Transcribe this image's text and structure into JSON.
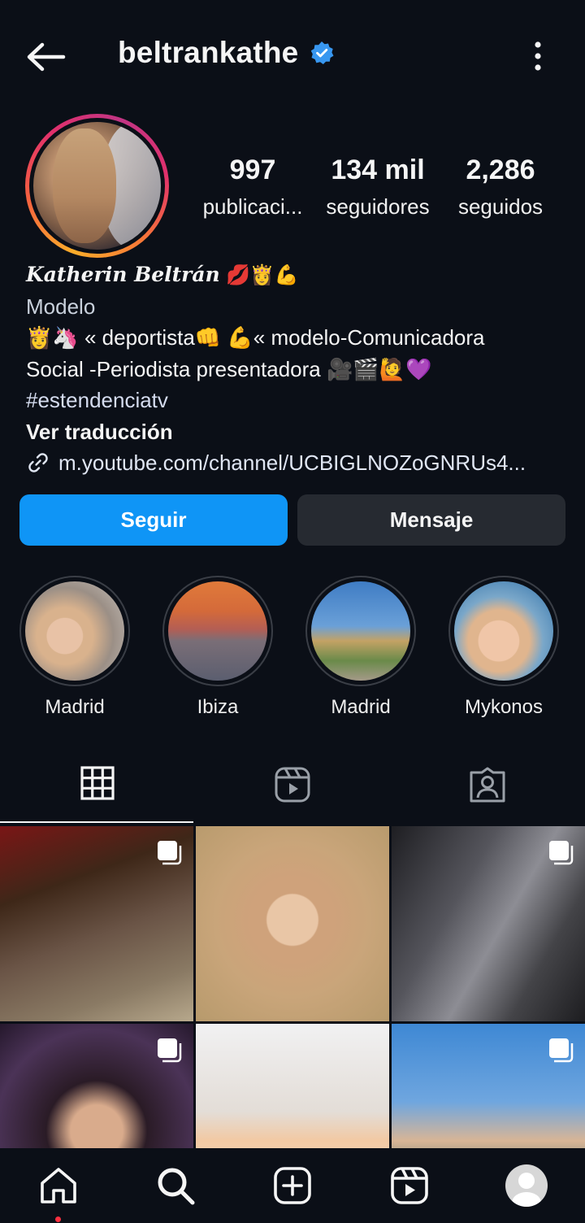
{
  "header": {
    "username": "beltrankathe",
    "back_icon": "back-arrow-icon",
    "verified_icon": "verified-badge-icon",
    "menu_icon": "more-vertical-icon",
    "verified_color": "#3897f0"
  },
  "stats": {
    "posts": {
      "value": "997",
      "label": "publicaci..."
    },
    "followers": {
      "value": "134 mil",
      "label": "seguidores"
    },
    "following": {
      "value": "2,286",
      "label": "seguidos"
    }
  },
  "bio": {
    "name": "Katherin Beltrán",
    "name_emojis": "💋👸💪",
    "category": "Modelo",
    "line1": "👸🦄 « deportista👊 💪« modelo-Comunicadora",
    "line2": "Social -Periodista presentadora 🎥🎬🙋💜",
    "hashtag": "#estendenciatv",
    "translate": "Ver traducción",
    "link": "m.youtube.com/channel/UCBIGLNOZoGNRUs4..."
  },
  "buttons": {
    "follow": "Seguir",
    "message": "Mensaje",
    "follow_color": "#0f95f6"
  },
  "highlights": [
    {
      "label": "Madrid"
    },
    {
      "label": "Ibiza"
    },
    {
      "label": "Madrid"
    },
    {
      "label": "Mykonos"
    }
  ],
  "tabs": [
    {
      "icon": "grid-icon",
      "active": true
    },
    {
      "icon": "reels-icon",
      "active": false
    },
    {
      "icon": "tagged-icon",
      "active": false
    }
  ],
  "nav": [
    {
      "icon": "home-icon"
    },
    {
      "icon": "search-icon"
    },
    {
      "icon": "create-icon"
    },
    {
      "icon": "reels-icon"
    },
    {
      "icon": "profile-icon"
    }
  ]
}
